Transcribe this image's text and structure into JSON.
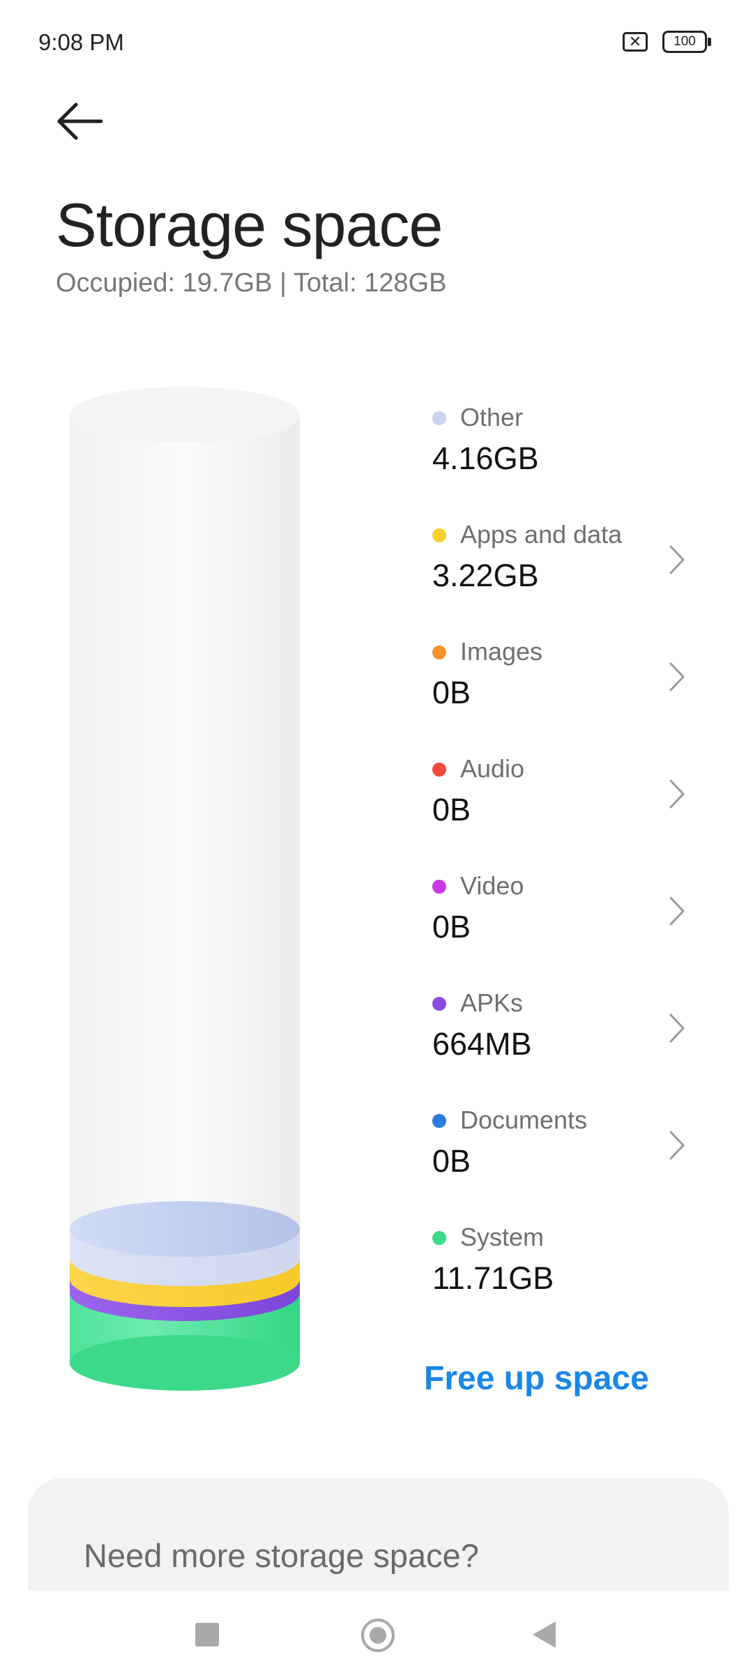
{
  "status_bar": {
    "time": "9:08 PM",
    "sim_icon_name": "no-sim-icon",
    "battery_level": "100"
  },
  "header": {
    "back_icon_name": "arrow-left-icon",
    "title": "Storage space",
    "subtitle": "Occupied: 19.7GB | Total: 128GB"
  },
  "storage_categories": [
    {
      "label": "Other",
      "value": "4.16GB",
      "color": "#c9d3ef",
      "has_chevron": false
    },
    {
      "label": "Apps and data",
      "value": "3.22GB",
      "color": "#f7cf2d",
      "has_chevron": true
    },
    {
      "label": "Images",
      "value": "0B",
      "color": "#f7922a",
      "has_chevron": true
    },
    {
      "label": "Audio",
      "value": "0B",
      "color": "#f44a3d",
      "has_chevron": true
    },
    {
      "label": "Video",
      "value": "0B",
      "color": "#c93ae6",
      "has_chevron": true
    },
    {
      "label": "APKs",
      "value": "664MB",
      "color": "#8a4be0",
      "has_chevron": true
    },
    {
      "label": "Documents",
      "value": "0B",
      "color": "#2a7ae2",
      "has_chevron": true
    },
    {
      "label": "System",
      "value": "11.71GB",
      "color": "#3bd98a",
      "has_chevron": false
    }
  ],
  "actions": {
    "free_up_label": "Free up space"
  },
  "promo": {
    "text": "Need more storage space?"
  },
  "nav_bar": {
    "recents_icon": "square-recents-icon",
    "home_icon": "circle-home-icon",
    "back_icon": "triangle-back-icon"
  }
}
